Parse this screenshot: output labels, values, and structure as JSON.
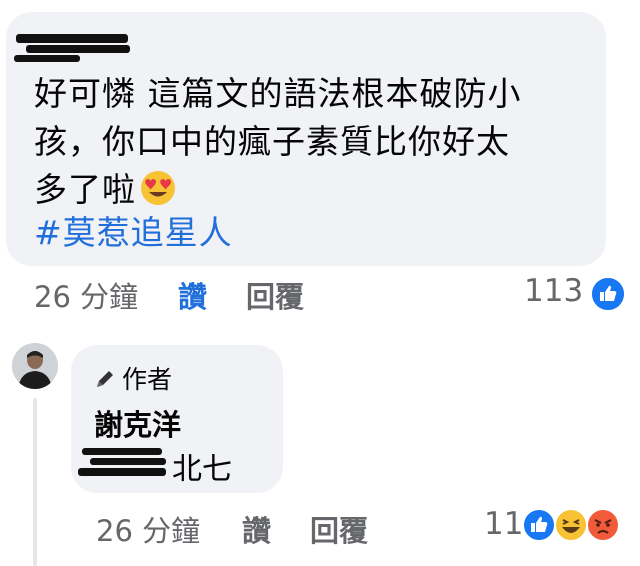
{
  "comment1": {
    "text_line1": "好可憐 這篇文的語法根本破防小",
    "text_line2": "孩，你口中的瘋子素質比你好太",
    "text_line3": "多了啦",
    "emoji": "heart-eyes-emoji",
    "hashtag": "#莫惹追星人",
    "time": "26 分鐘",
    "like_label": "讚",
    "reply_label": "回覆",
    "reaction_count": "113",
    "reactions": [
      "like-icon"
    ]
  },
  "reply": {
    "author_badge": "作者",
    "author_name": "謝克洋",
    "text_visible": "北七",
    "time": "26 分鐘",
    "like_label": "讚",
    "reply_label": "回覆",
    "reaction_count": "11",
    "reactions": [
      "like-icon",
      "haha-icon",
      "angry-icon"
    ]
  },
  "colors": {
    "bubble": "#f0f2f5",
    "link": "#216fdb",
    "meta": "#65676b",
    "like_blue": "#1877f2"
  }
}
